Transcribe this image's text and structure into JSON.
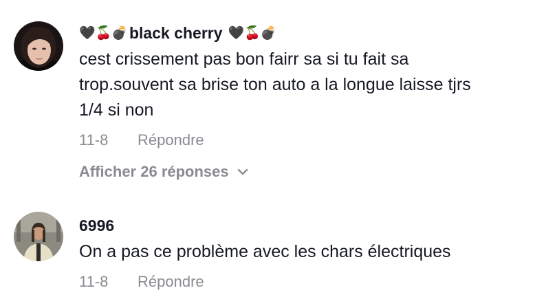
{
  "comments": [
    {
      "username_prefix": "🖤🍒💣",
      "username": "black cherry",
      "username_suffix": "🖤🍒💣",
      "text_lines": [
        "cest crissement pas bon fairr sa si tu fait sa",
        "trop.souvent sa brise ton auto a la longue laisse tjrs",
        "1/4 si non"
      ],
      "date": "11-8",
      "reply_label": "Répondre",
      "view_replies_label": "Afficher 26 réponses"
    },
    {
      "username": "6996",
      "text_lines": [
        "On a pas ce problème avec les chars électriques"
      ],
      "date": "11-8",
      "reply_label": "Répondre"
    }
  ],
  "icons": {
    "chevron": "chevron-down-icon"
  },
  "colors": {
    "text_primary": "#161823",
    "text_secondary": "#8a8b91"
  }
}
